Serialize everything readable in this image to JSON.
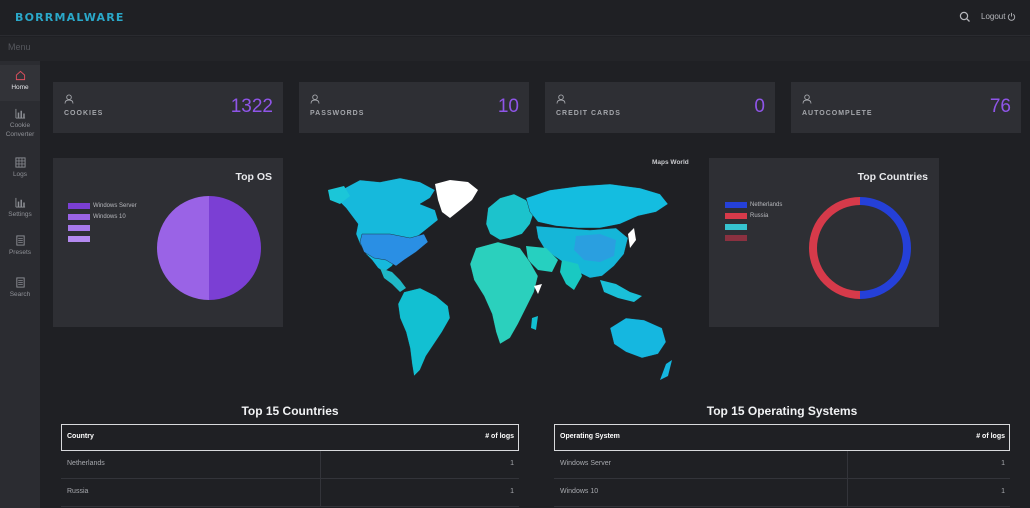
{
  "app": {
    "brand": "BORRMALWARE"
  },
  "header": {
    "logout_label": "Logout"
  },
  "menu": {
    "label": "Menu"
  },
  "sidebar": {
    "items": [
      {
        "label": "Home",
        "icon": "home-icon"
      },
      {
        "label": "Cookie Converter",
        "icon": "bar-chart-icon"
      },
      {
        "label": "Logs",
        "icon": "grid-icon"
      },
      {
        "label": "Settings",
        "icon": "bar-chart-icon"
      },
      {
        "label": "Presets",
        "icon": "document-icon"
      },
      {
        "label": "Search",
        "icon": "document-icon"
      }
    ]
  },
  "stats": [
    {
      "title": "COOKIES",
      "value": "1322"
    },
    {
      "title": "PASSWORDS",
      "value": "10"
    },
    {
      "title": "CREDIT CARDS",
      "value": "0"
    },
    {
      "title": "AUTOCOMPLETE",
      "value": "76"
    }
  ],
  "top_os": {
    "title": "Top OS",
    "legend": [
      {
        "label": "Windows Server",
        "color": "#7b3fd4"
      },
      {
        "label": "Windows 10",
        "color": "#9a63e6"
      },
      {
        "label": "",
        "color": "#a678ea"
      },
      {
        "label": "",
        "color": "#b48af0"
      }
    ]
  },
  "map": {
    "title": "Maps World"
  },
  "top_countries": {
    "title": "Top Countries",
    "legend": [
      {
        "label": "Netherlands",
        "color": "#2540d8"
      },
      {
        "label": "Russia",
        "color": "#d63a4a"
      },
      {
        "label": "",
        "color": "#36c3cf"
      },
      {
        "label": "",
        "color": "#8a3140"
      }
    ]
  },
  "chart_data": [
    {
      "type": "pie",
      "title": "Top OS",
      "categories": [
        "Windows Server",
        "Windows 10"
      ],
      "values": [
        1,
        1
      ],
      "colors": [
        "#7b3fd4",
        "#9a63e6"
      ]
    },
    {
      "type": "pie",
      "title": "Top Countries",
      "categories": [
        "Netherlands",
        "Russia"
      ],
      "values": [
        1,
        1
      ],
      "colors": [
        "#2540d8",
        "#d63a4a"
      ]
    }
  ],
  "countries_table": {
    "title": "Top 15 Countries",
    "col1": "Country",
    "col2": "# of logs",
    "rows": [
      {
        "name": "Netherlands",
        "count": "1"
      },
      {
        "name": "Russia",
        "count": "1"
      }
    ]
  },
  "os_table": {
    "title": "Top 15 Operating Systems",
    "col1": "Operating System",
    "col2": "# of logs",
    "rows": [
      {
        "name": "Windows Server",
        "count": "1"
      },
      {
        "name": "Windows 10",
        "count": "1"
      }
    ]
  }
}
